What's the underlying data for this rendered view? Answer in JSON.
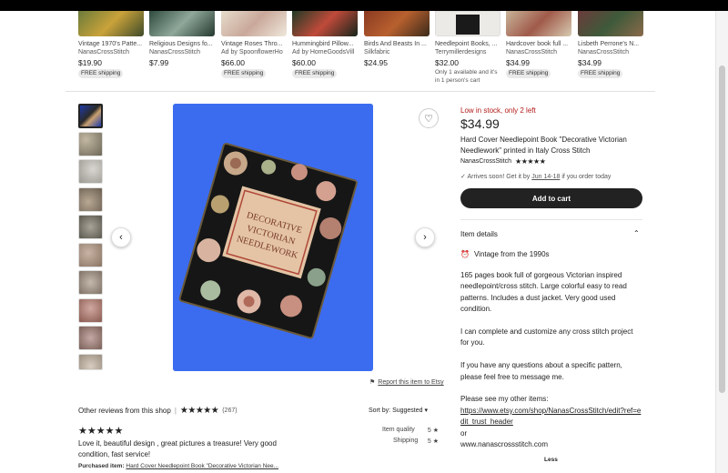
{
  "related_listings": [
    {
      "title": "Vintage 1970's Patte...",
      "seller": "NanasCrossStitch",
      "price": "$19.90",
      "badge": "FREE shipping",
      "thumb_color": "#6b7b3a"
    },
    {
      "title": "Religious Designs fo...",
      "seller": "NanasCrossStitch",
      "price": "$7.99",
      "badge": "",
      "thumb_color": "#3e5b4a"
    },
    {
      "title": "Vintage Roses Thro...",
      "seller": "Ad by SpoonflowerHo",
      "price": "$66.00",
      "badge": "FREE shipping",
      "thumb_color": "#d9cbb5"
    },
    {
      "title": "Hummingbird Pillow...",
      "seller": "Ad by HomeGoodsVill",
      "price": "$60.00",
      "badge": "FREE shipping",
      "thumb_color": "#1f3a25"
    },
    {
      "title": "Birds And Beasts In ...",
      "seller": "Silkfabric",
      "price": "$24.95",
      "badge": "",
      "thumb_color": "#8a3a22"
    },
    {
      "title": "Needlepoint Books, ...",
      "seller": "Terrymillerdesigns",
      "price": "$32.00",
      "badge": "",
      "note": "Only 1 available and it's in 1 person's cart",
      "thumb_color": "#e8e6e2"
    },
    {
      "title": "Hardcover book full ...",
      "seller": "NanasCrossStitch",
      "price": "$34.99",
      "badge": "FREE shipping",
      "thumb_color": "#c9b59a"
    },
    {
      "title": "Lisbeth Perrone's N...",
      "seller": "NanasCrossStitch",
      "price": "$34.99",
      "badge": "FREE shipping",
      "thumb_color": "#6a3b3b"
    }
  ],
  "thumbnail_colors": [
    "#2a3a6a",
    "#a9a08f",
    "#b7b4ad",
    "#9a8c7a",
    "#8e8a80",
    "#a8968a",
    "#a2978c",
    "#b08a80",
    "#a08a88",
    "#b8aca0"
  ],
  "gallery": {
    "fav_icon": "heart-icon",
    "prev_icon": "chevron-left-icon",
    "next_icon": "chevron-right-icon",
    "report_label": "Report this item to Etsy",
    "cover_title_l1": "DECORATIVE",
    "cover_title_l2": "VICTORIAN",
    "cover_title_l3": "NEEDLEWORK",
    "bg_color": "#3b6cf0"
  },
  "product": {
    "stock": "Low in stock, only 2 left",
    "price": "$34.99",
    "title": "Hard Cover Needlepoint Book \"Decorative Victorian Needlework\" printed in Italy Cross Stitch",
    "shop_name": "NanasCrossStitch",
    "shop_stars": "★★★★★",
    "arrives_pre": "Arrives soon! Get it by ",
    "arrives_date": "Jun 14-18",
    "arrives_post": " if you order today",
    "cart_label": "Add to cart",
    "details_label": "Item details",
    "vintage": "Vintage from the 1990s",
    "desc1": "165 pages book full of gorgeous Victorian inspired needlepoint/cross stitch. Large colorful easy to read patterns. Includes a dust jacket. Very good used condition.",
    "desc2": "I can complete and customize any cross stitch project for you.",
    "desc3": "If you have any questions about a specific pattern, please feel free to message me.",
    "desc4": "Please see my other items:",
    "link": "https://www.etsy.com/shop/NanasCrossStitch/edit?ref=edit_trust_header",
    "or": "or",
    "site": "www.nanascrossstitch.com",
    "less_label": "Less",
    "accent_color": "#b21a18"
  },
  "reviews": {
    "header": "Other reviews from this shop",
    "header_stars": "★★★★★",
    "count": "(267)",
    "sort_label": "Sort by: Suggested",
    "review_stars": "★★★★★",
    "review_text": "Love it, beautiful design , great pictures a treasure! Very good condition, fast service!",
    "purchased_label": "Purchased item:",
    "purchased_item": "Hard Cover Needlepoint Book \"Decorative Victorian Nee...",
    "metrics": [
      {
        "label": "Item quality",
        "value": "5 ★"
      },
      {
        "label": "Shipping",
        "value": "5 ★"
      }
    ]
  }
}
